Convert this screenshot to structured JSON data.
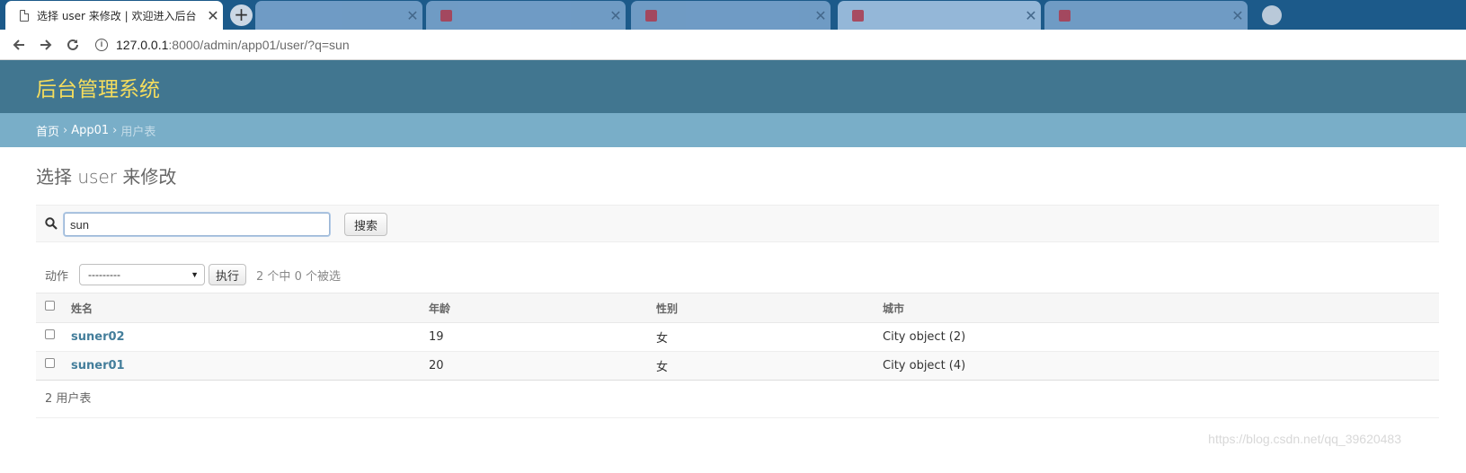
{
  "browser": {
    "active_tab_title": "选择 user 来修改 | 欢迎进入后台",
    "active_tab_close": "✕",
    "new_tab_symbol": "+",
    "url_host": "127.0.0.1",
    "url_rest": ":8000/admin/app01/user/?q=sun",
    "info_symbol": "i"
  },
  "admin": {
    "branding": "后台管理系统",
    "breadcrumbs": {
      "home": "首页",
      "app": "App01",
      "current": "用户表",
      "separator": "›"
    },
    "page_title": "选择 user 来修改",
    "search": {
      "value": "sun",
      "button_label": "搜索"
    },
    "actions": {
      "label": "动作",
      "selected_option": "---------",
      "go_label": "执行",
      "counter": "2 个中 0 个被选"
    },
    "table": {
      "columns": [
        "姓名",
        "年龄",
        "性别",
        "城市"
      ],
      "rows": [
        {
          "name": "suner02",
          "age": "19",
          "gender": "女",
          "city": "City object (2)"
        },
        {
          "name": "suner01",
          "age": "20",
          "gender": "女",
          "city": "City object (4)"
        }
      ]
    },
    "paginator": "2 用户表"
  },
  "watermark": "https://blog.csdn.net/qq_39620483",
  "colors": {
    "header_bg": "#417690",
    "branding": "#f5dd5d",
    "breadcrumbs_bg": "#79aec8",
    "link": "#447e9b"
  }
}
